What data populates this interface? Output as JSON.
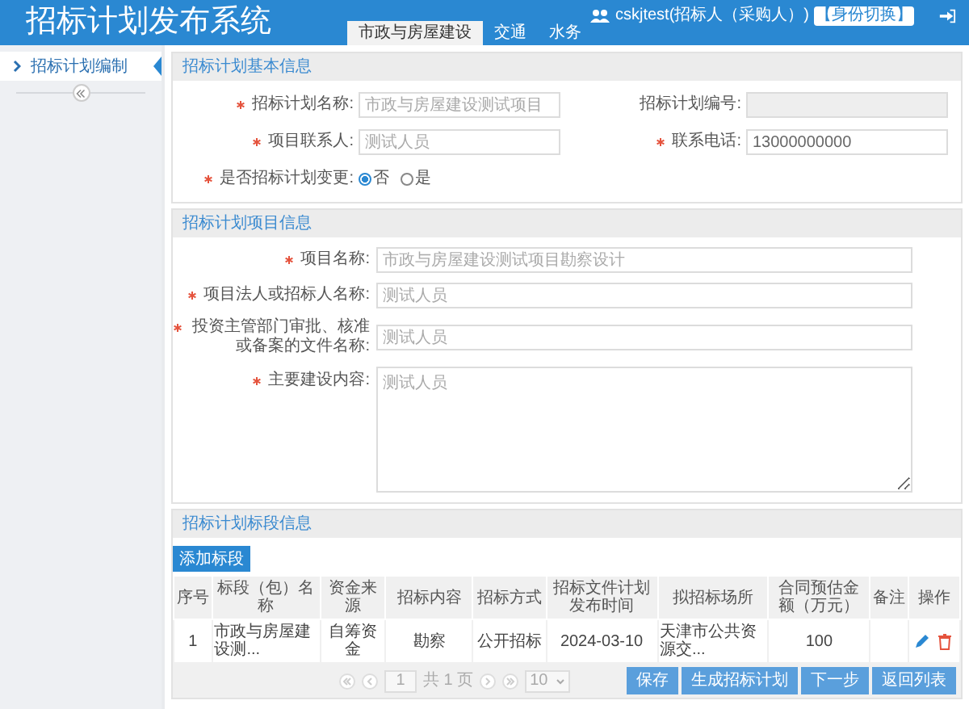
{
  "header": {
    "title": "招标计划发布系统",
    "tabs": [
      {
        "label": "市政与房屋建设",
        "selected": true
      },
      {
        "label": "交通",
        "selected": false
      },
      {
        "label": "水务",
        "selected": false
      }
    ],
    "user": "cskjtest(招标人（采购人）)",
    "switch_button": "【身份切换】"
  },
  "sidebar": {
    "items": [
      {
        "label": "招标计划编制",
        "selected": true
      }
    ]
  },
  "basic_info": {
    "title": "招标计划基本信息",
    "fields": [
      {
        "kind": "text",
        "label": "招标计划名称:",
        "required": true,
        "placeholder": "市政与房屋建设测试项目",
        "disabled": false
      },
      {
        "kind": "text",
        "label": "招标计划编号:",
        "required": false,
        "disabled": true
      },
      {
        "kind": "text",
        "label": "项目联系人:",
        "required": true,
        "placeholder": "测试人员",
        "disabled": false
      },
      {
        "kind": "text",
        "label": "联系电话:",
        "required": true,
        "value": "13000000000",
        "disabled": false
      },
      {
        "kind": "radio",
        "label": "是否招标计划变更:",
        "required": true,
        "options": [
          {
            "label": "否",
            "selected": true
          },
          {
            "label": "是",
            "selected": false
          }
        ]
      }
    ]
  },
  "project_info": {
    "title": "招标计划项目信息",
    "fields": [
      {
        "kind": "text",
        "label": "项目名称:",
        "required": true,
        "placeholder": "市政与房屋建设测试项目勘察设计"
      },
      {
        "kind": "text",
        "label": "项目法人或招标人名称:",
        "required": true,
        "placeholder": "测试人员"
      },
      {
        "kind": "text",
        "label": "投资主管部门审批、核准或备案的文件名称:",
        "required": true,
        "placeholder": "测试人员"
      },
      {
        "kind": "textarea",
        "label": "主要建设内容:",
        "required": true,
        "placeholder": "测试人员"
      }
    ]
  },
  "section_info": {
    "title": "招标计划标段信息",
    "add_button": "添加标段",
    "table": {
      "columns": [
        "序号",
        "标段（包）名称",
        "资金来源",
        "招标内容",
        "招标方式",
        "招标文件计划发布时间",
        "拟招标场所",
        "合同预估金额（万元）",
        "备注",
        "操作"
      ],
      "rows": [
        {
          "cells": [
            "1",
            "市政与房屋建设测...",
            "自筹资金",
            "勘察",
            "公开招标",
            "2024-03-10",
            "天津市公共资源交...",
            "100",
            ""
          ]
        }
      ]
    },
    "pagination": {
      "page": "1",
      "total_pages": "共 1 页",
      "page_size": "10"
    }
  },
  "buttons": [
    "保存",
    "生成招标计划",
    "下一步",
    "返回列表"
  ]
}
